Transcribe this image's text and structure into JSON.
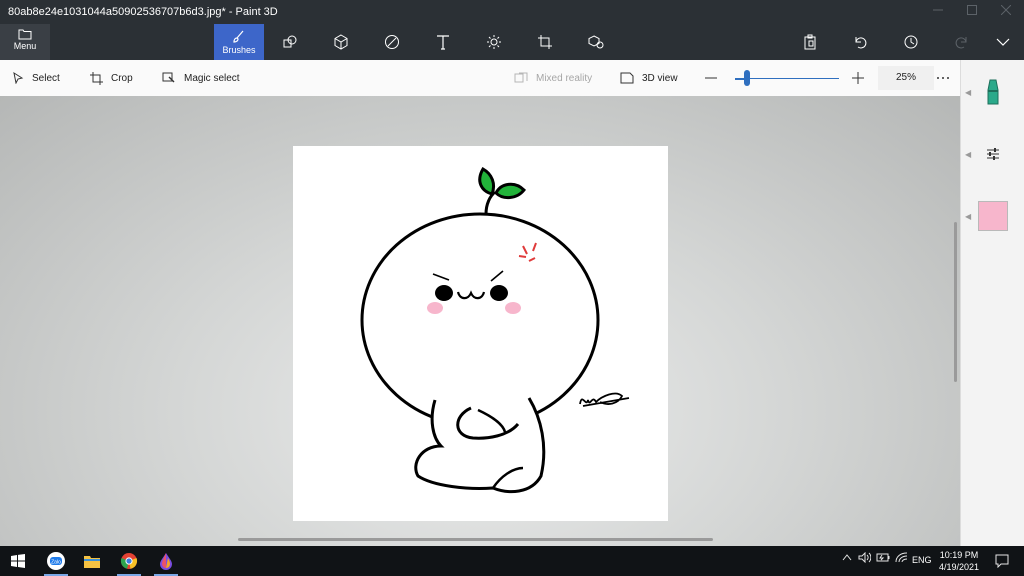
{
  "window": {
    "title": "80ab8e24e1031044a50902536707b6d3.jpg* - Paint 3D",
    "controls": [
      "minimize",
      "maximize",
      "close"
    ]
  },
  "ribbon": {
    "menu_label": "Menu",
    "active_tool_label": "Brushes",
    "tools": [
      "brushes-icon",
      "2d-shapes-icon",
      "3d-shapes-icon",
      "stickers-icon",
      "text-icon",
      "effects-icon",
      "canvas-icon",
      "3d-library-icon"
    ],
    "right_tools": [
      "paste-icon",
      "undo-icon",
      "history-icon",
      "redo-icon",
      "expand-icon"
    ]
  },
  "toolbar": {
    "select_label": "Select",
    "crop_label": "Crop",
    "magic_select_label": "Magic select",
    "mixed_reality_label": "Mixed reality",
    "view_3d_label": "3D view",
    "zoom_value": "25%",
    "zoom_slider_fraction": 0.09
  },
  "sidepanel": {
    "brush_color": "#2aa98a",
    "selected_color": "#f7b6cc"
  },
  "taskbar": {
    "apps": [
      "start-icon",
      "zalo-icon",
      "file-explorer-icon",
      "chrome-icon",
      "paint-3d-icon"
    ],
    "language": "ENG",
    "time": "10:19 PM",
    "date": "4/19/2021"
  },
  "colors": {
    "ribbon_bg": "#2b3035",
    "active_tool": "#3d66c9",
    "slider_accent": "#2f6fbf",
    "leaf_green": "#22b33a",
    "anger_mark_red": "#e03b3b",
    "blush_pink": "#f7b6cc"
  }
}
